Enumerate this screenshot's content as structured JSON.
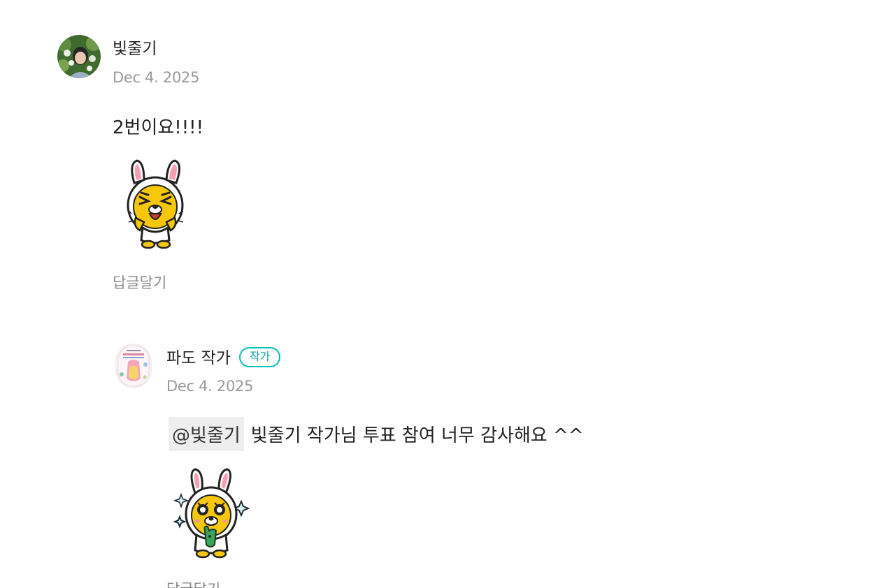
{
  "comments": [
    {
      "author": "빛줄기",
      "date": "Dec 4. 2025",
      "text": "2번이요!!!!",
      "sticker": "rabbit-lion-laughing-sticker",
      "reply_label": "답글달기"
    },
    {
      "author": "파도 작가",
      "badge": "작가",
      "date": "Dec 4. 2025",
      "mention": "@빛줄기",
      "text": "빛줄기 작가님 투표 참여 너무 감사해요 ^^",
      "sticker": "rabbit-lion-sparkle-sticker",
      "reply_label": "답글달기"
    }
  ],
  "colors": {
    "badge": "#00c3bd",
    "muted": "#9a9a9a",
    "mention_bg": "#eeeeee"
  }
}
